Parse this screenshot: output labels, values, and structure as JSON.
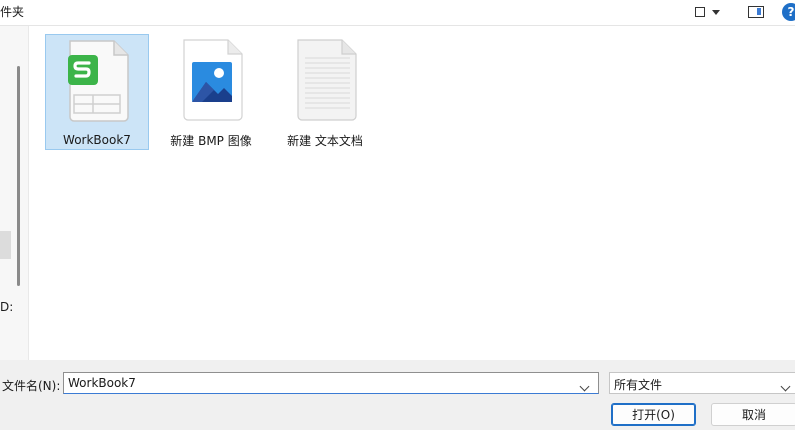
{
  "toolbar": {
    "breadcrumb": "件夹",
    "help_glyph": "?"
  },
  "nav": {
    "fragment": "D:"
  },
  "files": [
    {
      "name": "WorkBook7",
      "type": "spreadsheet",
      "selected": true,
      "icon": "spreadsheet-file-icon"
    },
    {
      "name": "新建 BMP 图像",
      "type": "bmp",
      "selected": false,
      "icon": "image-file-icon"
    },
    {
      "name": "新建 文本文档",
      "type": "txt",
      "selected": false,
      "icon": "text-file-icon"
    }
  ],
  "bottom": {
    "filename_label": "文件名(N):",
    "filename_value": "WorkBook7",
    "filetype_selected": "所有文件",
    "open_label": "打开(O)",
    "cancel_label": "取消"
  },
  "colors": {
    "selection_bg": "#cce4f7",
    "selection_border": "#99c9ef",
    "accent": "#1f6fc7",
    "spreadsheet_green": "#3cb449"
  }
}
